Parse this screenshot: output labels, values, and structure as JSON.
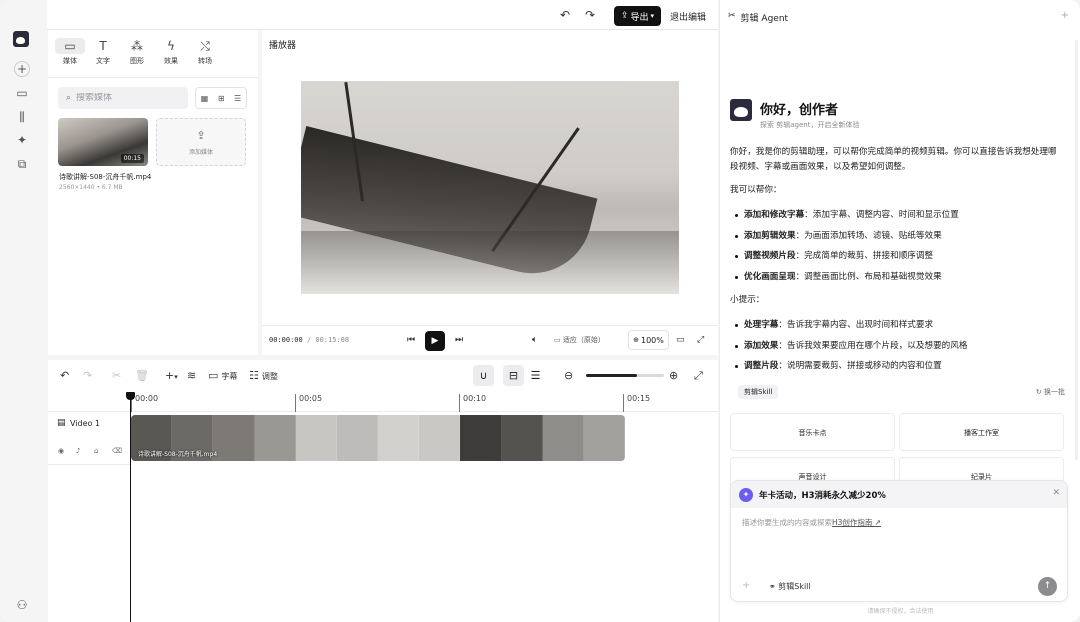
{
  "window": {
    "traffic": [
      "#ff5f57",
      "#febc2e",
      "#28c840"
    ]
  },
  "topbar": {
    "export_label": "导出",
    "exit_label": "退出编辑"
  },
  "library": {
    "tabs": [
      {
        "label": "媒体",
        "icon": "media-icon"
      },
      {
        "label": "文字",
        "icon": "text-icon"
      },
      {
        "label": "图形",
        "icon": "shapes-icon"
      },
      {
        "label": "效果",
        "icon": "effects-icon"
      },
      {
        "label": "转场",
        "icon": "transition-icon"
      }
    ],
    "search_placeholder": "搜索媒体",
    "clip": {
      "duration": "00:15",
      "name": "诗歌讲解-S08-沉舟千帆.mp4",
      "meta": "2560×1440 • 6.7 MB"
    },
    "add_media_label": "添加媒体"
  },
  "player": {
    "title": "播放器",
    "current_time": "00:00:00",
    "total_time": "/ 00:15:08",
    "fit_label": "适应（原始）",
    "zoom": "100%"
  },
  "timeline": {
    "subtitle_label": "字幕",
    "adjust_label": "调整",
    "zoom_level": 0.65,
    "ticks": [
      "00:00",
      "00:05",
      "00:10",
      "00:15"
    ],
    "track_name": "Video 1",
    "clip_name": "诗歌讲解-S08-沉舟千帆.mp4"
  },
  "agent": {
    "title": "剪辑 Agent",
    "greeting": "你好，创作者",
    "subtitle": "探索 剪辑agent，开启全新体验",
    "intro": "你好，我是你的剪辑助理，可以帮你完成简单的视频剪辑。你可以直接告诉我想处理哪段视频、字幕或画面效果，以及希望如何调整。",
    "can_help": "我可以帮你：",
    "help_items": [
      {
        "b": "添加和修改字幕",
        "t": "：添加字幕、调整内容、时间和显示位置"
      },
      {
        "b": "添加剪辑效果",
        "t": "：为画面添加转场、滤镜、贴纸等效果"
      },
      {
        "b": "调整视频片段",
        "t": "：完成简单的裁剪、拼接和顺序调整"
      },
      {
        "b": "优化画面呈现",
        "t": "：调整画面比例、布局和基础视觉效果"
      }
    ],
    "tips_title": "小提示：",
    "tips": [
      {
        "b": "处理字幕",
        "t": "：告诉我字幕内容、出现时间和样式要求"
      },
      {
        "b": "添加效果",
        "t": "：告诉我效果要应用在哪个片段，以及想要的风格"
      },
      {
        "b": "调整片段",
        "t": "：说明需要裁剪、拼接或移动的内容和位置"
      }
    ],
    "skill_tag": "剪辑Skill",
    "refresh_label": "换一批",
    "cards": [
      "音乐卡点",
      "播客工作室",
      "声音设计",
      "纪录片"
    ],
    "promo_title": "年卡活动，H3消耗永久减少20%",
    "input_placeholder": "描述你要生成的内容或探索",
    "input_link": "H3创作指南 ↗",
    "bottom_skill": "剪辑Skill",
    "disclaimer": "请确保不侵权，合法使用"
  }
}
